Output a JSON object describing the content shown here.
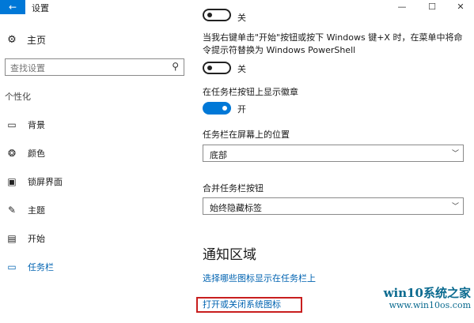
{
  "window": {
    "title": "设置",
    "back_icon": "←",
    "minimize_icon": "—",
    "maximize_icon": "☐",
    "close_icon": "✕"
  },
  "sidebar": {
    "home_label": "主页",
    "search_placeholder": "查找设置",
    "section_title": "个性化",
    "items": [
      {
        "label": "背景",
        "icon": "picture-icon"
      },
      {
        "label": "颜色",
        "icon": "palette-icon"
      },
      {
        "label": "锁屏界面",
        "icon": "lock-screen-icon"
      },
      {
        "label": "主题",
        "icon": "theme-icon"
      },
      {
        "label": "开始",
        "icon": "start-icon"
      },
      {
        "label": "任务栏",
        "icon": "taskbar-icon",
        "active": true
      }
    ]
  },
  "main": {
    "top_toggle_label": "关",
    "powershell_desc": "当我右键单击\"开始\"按钮或按下 Windows 键+X 时，在菜单中将命令提示符替换为 Windows PowerShell",
    "powershell_toggle_label": "关",
    "badges_label": "在任务栏按钮上显示徽章",
    "badges_toggle_label": "开",
    "position_label": "任务栏在屏幕上的位置",
    "position_value": "底部",
    "combine_label": "合并任务栏按钮",
    "combine_value": "始终隐藏标签",
    "notification_heading": "通知区域",
    "link_select_icons": "选择哪些图标显示在任务栏上",
    "link_system_icons": "打开或关闭系统图标"
  },
  "watermark": {
    "main": "win10系统之家",
    "sub": "www.win10os.com"
  },
  "colors": {
    "accent": "#0078d7",
    "link": "#0063b1",
    "highlight_border": "#c81e1e"
  }
}
